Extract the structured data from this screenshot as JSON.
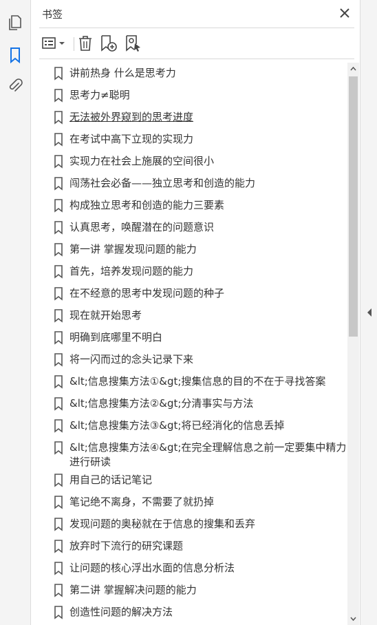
{
  "panel": {
    "title": "书签"
  },
  "leftbar": {
    "icons": [
      "pages-icon",
      "bookmark-icon",
      "attachment-icon"
    ],
    "active_color": "#1473e6"
  },
  "toolbar": {
    "buttons": [
      "options-menu",
      "delete-bookmark",
      "new-bookmark",
      "bookmark-from-selection"
    ]
  },
  "bookmarks": [
    {
      "label": "讲前热身 什么是思考力"
    },
    {
      "label": "思考力≠聪明"
    },
    {
      "label": "无法被外界窥到的思考进度",
      "underline": true
    },
    {
      "label": "在考试中高下立现的实现力"
    },
    {
      "label": "实现力在社会上施展的空间很小"
    },
    {
      "label": "闯荡社会必备——独立思考和创造的能力"
    },
    {
      "label": "构成独立思考和创造的能力三要素"
    },
    {
      "label": "认真思考，唤醒潜在的问题意识"
    },
    {
      "label": "第一讲 掌握发现问题的能力"
    },
    {
      "label": "首先，培养发现问题的能力"
    },
    {
      "label": "在不经意的思考中发现问题的种子"
    },
    {
      "label": "现在就开始思考"
    },
    {
      "label": "明确到底哪里不明白"
    },
    {
      "label": "将一闪而过的念头记录下来"
    },
    {
      "label": "&lt;信息搜集方法①&gt;搜集信息的目的不在于寻找答案"
    },
    {
      "label": "&lt;信息搜集方法②&gt;分清事实与方法"
    },
    {
      "label": "&lt;信息搜集方法③&gt;将已经消化的信息丢掉"
    },
    {
      "label": "&lt;信息搜集方法④&gt;在完全理解信息之前一定要集中精力进行研读"
    },
    {
      "label": "用自己的话记笔记"
    },
    {
      "label": "笔记绝不离身，不需要了就扔掉"
    },
    {
      "label": "发现问题的奥秘就在于信息的搜集和丢弃"
    },
    {
      "label": "放弃时下流行的研究课题"
    },
    {
      "label": "让问题的核心浮出水面的信息分析法"
    },
    {
      "label": "第二讲 掌握解决问题的能力"
    },
    {
      "label": "创造性问题的解决方法"
    }
  ]
}
